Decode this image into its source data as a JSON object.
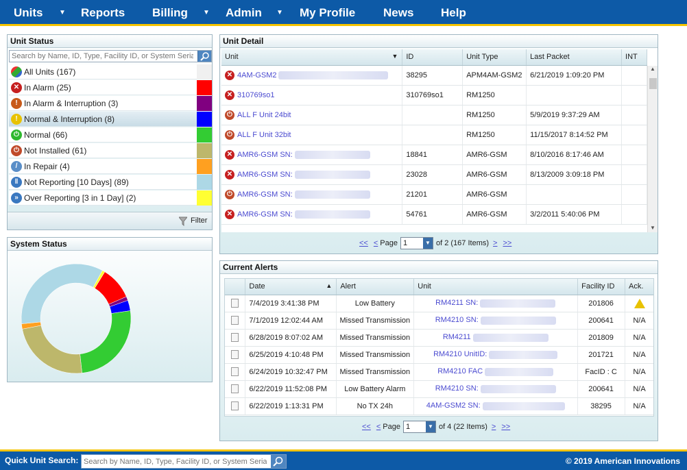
{
  "nav": {
    "items": [
      {
        "label": "Units",
        "caret": true
      },
      {
        "label": "Reports",
        "caret": false
      },
      {
        "label": "Billing",
        "caret": true
      },
      {
        "label": "Admin",
        "caret": true
      },
      {
        "label": "My Profile",
        "caret": false
      },
      {
        "label": "News",
        "caret": false
      },
      {
        "label": "Help",
        "caret": false
      }
    ]
  },
  "unit_status": {
    "title": "Unit Status",
    "search_placeholder": "Search by Name, ID, Type, Facility ID, or System Serial",
    "filter_label": "Filter",
    "rows": [
      {
        "label": "All Units (167)",
        "icon": "cube-icon",
        "color": "#f0f0f0"
      },
      {
        "label": "In Alarm (25)",
        "icon": "alarm-x-icon",
        "color": "#ff0000"
      },
      {
        "label": "In Alarm & Interruption (3)",
        "icon": "alarm-interruption-icon",
        "color": "#800080"
      },
      {
        "label": "Normal & Interruption (8)",
        "icon": "exclamation-icon",
        "color": "#0000ff"
      },
      {
        "label": "Normal (66)",
        "icon": "power-green-icon",
        "color": "#33cc33"
      },
      {
        "label": "Not Installed (61)",
        "icon": "power-red-icon",
        "color": "#bdb76b"
      },
      {
        "label": "In Repair (4)",
        "icon": "wrench-icon",
        "color": "#ffa020"
      },
      {
        "label": "Not Reporting [10 Days] (89)",
        "icon": "pause-icon",
        "color": "#add8e6"
      },
      {
        "label": "Over Reporting [3 in 1 Day] (2)",
        "icon": "fast-forward-icon",
        "color": "#ffff33"
      }
    ]
  },
  "system_status": {
    "title": "System Status"
  },
  "chart_data": {
    "type": "pie",
    "title": "",
    "categories": [
      "In Alarm",
      "In Alarm & Interruption",
      "Normal & Interruption",
      "Normal",
      "Not Installed",
      "In Repair",
      "Not Reporting [10 Days]",
      "Over Reporting [3 in 1 Day]"
    ],
    "values": [
      25,
      3,
      8,
      66,
      61,
      4,
      89,
      2
    ],
    "colors": [
      "#ff0000",
      "#800080",
      "#0000ff",
      "#33cc33",
      "#bdb76b",
      "#ffa020",
      "#add8e6",
      "#ffff33"
    ]
  },
  "unit_detail": {
    "title": "Unit Detail",
    "columns": [
      "Unit",
      "ID",
      "Unit Type",
      "Last Packet",
      "INT"
    ],
    "rows": [
      {
        "status": "alarm",
        "unit": "4AM-GSM2",
        "id": "38295",
        "type": "APM4AM-GSM2",
        "last": "6/21/2019 1:09:20 PM"
      },
      {
        "status": "alarm",
        "unit": "310769so1",
        "id": "310769so1",
        "type": "RM1250",
        "last": ""
      },
      {
        "status": "power",
        "unit": "ALL F Unit 24bit",
        "id": "",
        "type": "RM1250",
        "last": "5/9/2019 9:37:29 AM"
      },
      {
        "status": "power",
        "unit": "ALL F Unit 32bit",
        "id": "",
        "type": "RM1250",
        "last": "11/15/2017 8:14:52 PM"
      },
      {
        "status": "alarm",
        "unit": "AMR6-GSM SN:",
        "id": "18841",
        "type": "AMR6-GSM",
        "last": "8/10/2016 8:17:46 AM"
      },
      {
        "status": "alarm",
        "unit": "AMR6-GSM SN:",
        "id": "23028",
        "type": "AMR6-GSM",
        "last": "8/13/2009 3:09:18 PM"
      },
      {
        "status": "power",
        "unit": "AMR6-GSM SN:",
        "id": "21201",
        "type": "AMR6-GSM",
        "last": ""
      },
      {
        "status": "alarm",
        "unit": "AMR6-GSM SN:",
        "id": "54761",
        "type": "AMR6-GSM",
        "last": "3/2/2011 5:40:06 PM"
      }
    ],
    "pager": {
      "page_label": "Page",
      "page": "1",
      "summary": "of 2 (167 Items)",
      "first": "<<",
      "prev": "<",
      "next": ">",
      "last": ">>"
    }
  },
  "current_alerts": {
    "title": "Current Alerts",
    "columns": [
      "",
      "Date",
      "Alert",
      "Unit",
      "Facility ID",
      "Ack."
    ],
    "rows": [
      {
        "date": "7/4/2019 3:41:38 PM",
        "alert": "Low Battery",
        "unit": "RM4211 SN:",
        "facility": "201806",
        "ack": "",
        "warn": true
      },
      {
        "date": "7/1/2019 12:02:44 AM",
        "alert": "Missed Transmission",
        "unit": "RM4210 SN:",
        "facility": "200641",
        "ack": "N/A",
        "warn": false
      },
      {
        "date": "6/28/2019 8:07:02 AM",
        "alert": "Missed Transmission",
        "unit": "RM4211",
        "facility": "201809",
        "ack": "N/A",
        "warn": false
      },
      {
        "date": "6/25/2019 4:10:48 PM",
        "alert": "Missed Transmission",
        "unit": "RM4210 UnitID:",
        "facility": "201721",
        "ack": "N/A",
        "warn": false
      },
      {
        "date": "6/24/2019 10:32:47 PM",
        "alert": "Missed Transmission",
        "unit": "RM4210 FAC",
        "facility": "FacID : C",
        "ack": "N/A",
        "warn": false
      },
      {
        "date": "6/22/2019 11:52:08 PM",
        "alert": "Low Battery Alarm",
        "unit": "RM4210 SN:",
        "facility": "200641",
        "ack": "N/A",
        "warn": false
      },
      {
        "date": "6/22/2019 1:13:31 PM",
        "alert": "No TX 24h",
        "unit": "4AM-GSM2 SN:",
        "facility": "38295",
        "ack": "N/A",
        "warn": false
      }
    ],
    "pager": {
      "page_label": "Page",
      "page": "1",
      "summary": "of 4 (22 Items)",
      "first": "<<",
      "prev": "<",
      "next": ">",
      "last": ">>"
    }
  },
  "footer": {
    "quick_search_label": "Quick Unit Search:",
    "quick_search_placeholder": "Search by Name, ID, Type, Facility ID, or System Serial",
    "copyright": "© 2019 American Innovations"
  }
}
